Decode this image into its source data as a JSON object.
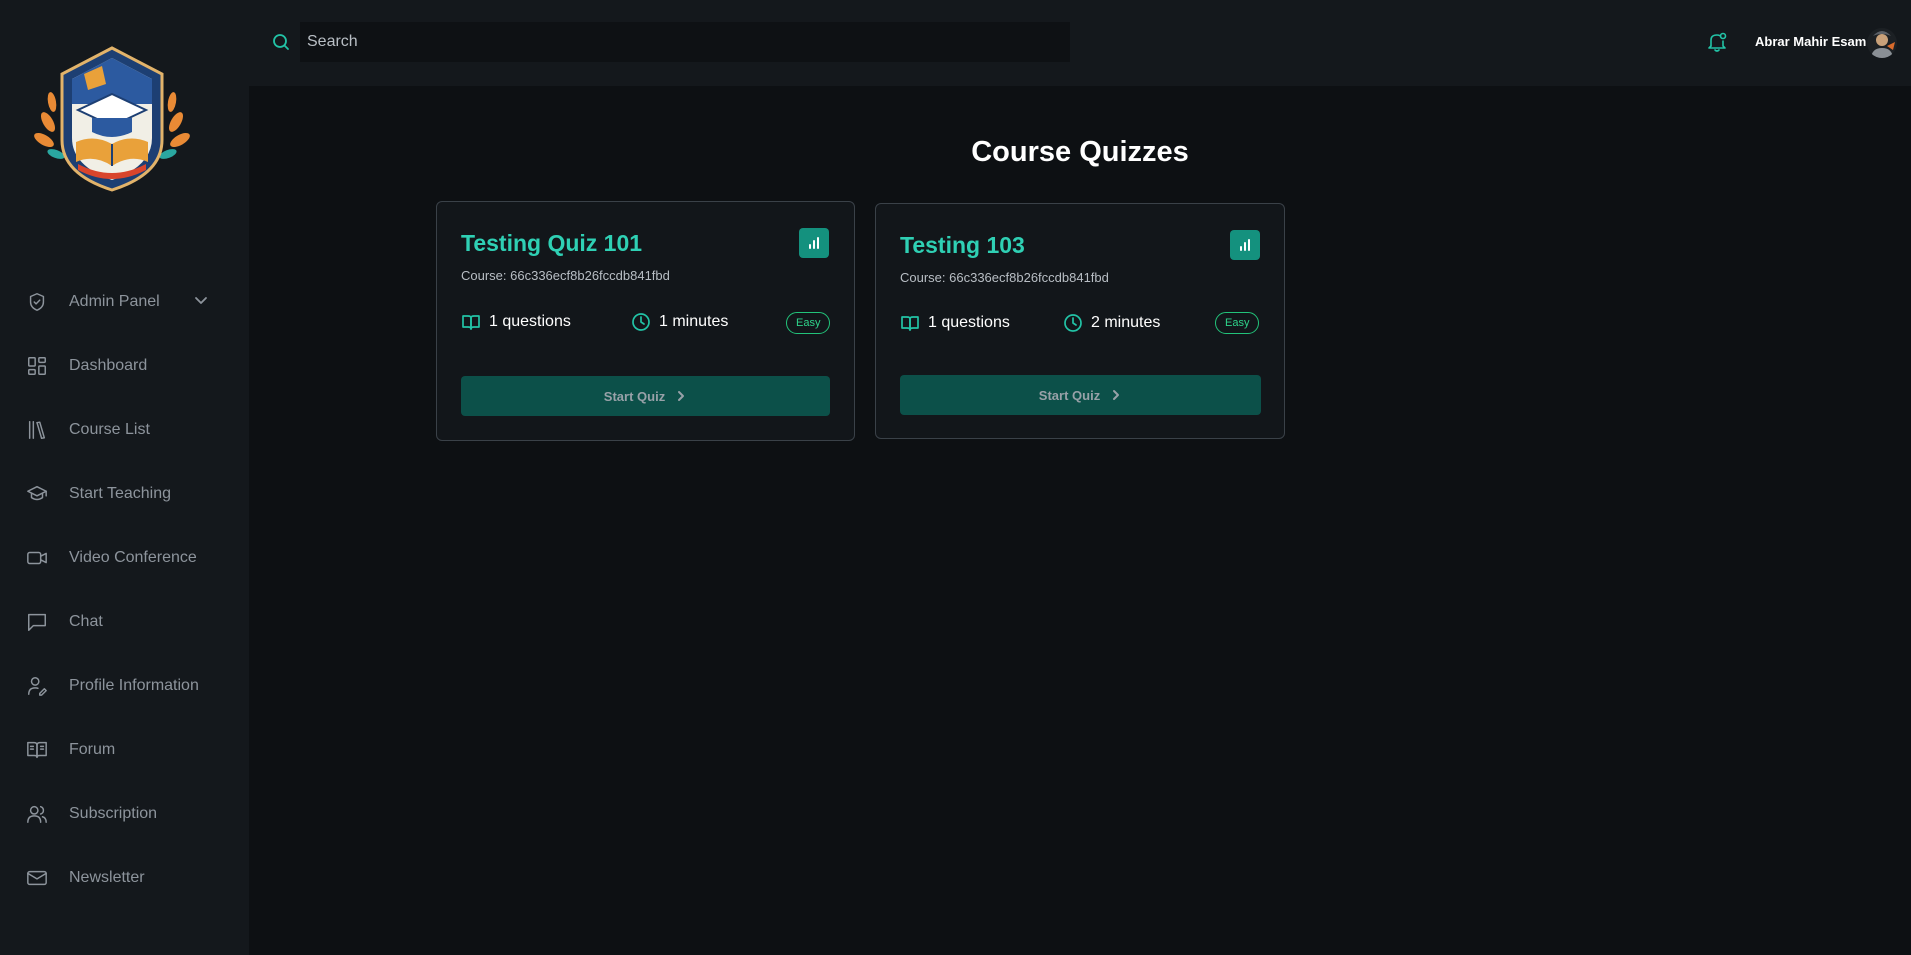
{
  "header": {
    "search_placeholder": "Search",
    "user_name": "Abrar Mahir Esam"
  },
  "sidebar": {
    "items": [
      {
        "label": "Admin Panel",
        "icon": "shield-check-icon",
        "has_chevron": true
      },
      {
        "label": "Dashboard",
        "icon": "dashboard-icon"
      },
      {
        "label": "Course List",
        "icon": "library-icon"
      },
      {
        "label": "Start Teaching",
        "icon": "graduation-cap-icon"
      },
      {
        "label": "Video Conference",
        "icon": "video-icon"
      },
      {
        "label": "Chat",
        "icon": "chat-icon"
      },
      {
        "label": "Profile Information",
        "icon": "user-edit-icon"
      },
      {
        "label": "Forum",
        "icon": "book-open-text-icon"
      },
      {
        "label": "Subscription",
        "icon": "users-icon"
      },
      {
        "label": "Newsletter",
        "icon": "mail-icon"
      }
    ]
  },
  "main": {
    "title": "Course Quizzes",
    "quizzes": [
      {
        "title": "Testing Quiz 101",
        "course": "Course: 66c336ecf8b26fccdb841fbd",
        "questions": "1 questions",
        "duration": "1 minutes",
        "difficulty": "Easy",
        "button": "Start Quiz"
      },
      {
        "title": "Testing 103",
        "course": "Course: 66c336ecf8b26fccdb841fbd",
        "questions": "1 questions",
        "duration": "2 minutes",
        "difficulty": "Easy",
        "button": "Start Quiz"
      }
    ]
  },
  "colors": {
    "accent": "#22c3a6",
    "button_bg": "#0c5049",
    "badge": "#2ed38a",
    "background": "#0d1013",
    "panel": "#14181c"
  }
}
